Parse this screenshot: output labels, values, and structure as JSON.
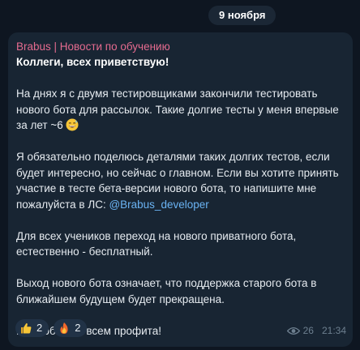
{
  "date_separator": "9 ноября",
  "message": {
    "sender": "Brabus | Новости по обучению",
    "greeting": "Коллеги, всех приветствую!",
    "para1": "На днях я с двумя тестировщиками закончили тестировать нового бота для рассылок. Такие долгие тесты у меня впервые за лет ~6",
    "para1_emoji": "grinning-sweat-emoji",
    "para2": "Я обязательно поделюсь деталями таких долгих тестов, если будет интересно, но сейчас о главном. Если вы хотите принять участие в тесте бета-версии нового бота, то напишите мне пожалуйста в ЛС: ",
    "mention": "@Brabus_developer",
    "para3": "Для всех учеников переход на нового приватного бота, естественно - бесплатный.",
    "para4": "Выход нового бота означает, что поддержка старого бота в ближайшем будущем будет прекращена.",
    "para5": "Всех обнял и всем профита!",
    "reactions": [
      {
        "icon": "thumbs-up-emoji",
        "count": "2"
      },
      {
        "icon": "fire-emoji",
        "count": "2"
      }
    ],
    "views": "26",
    "time": "21:34"
  },
  "colors": {
    "background": "#0e1621",
    "bubble": "#182533",
    "sender": "#e56b8f",
    "mention": "#6ab3f3",
    "meta": "#6d7f8f"
  }
}
